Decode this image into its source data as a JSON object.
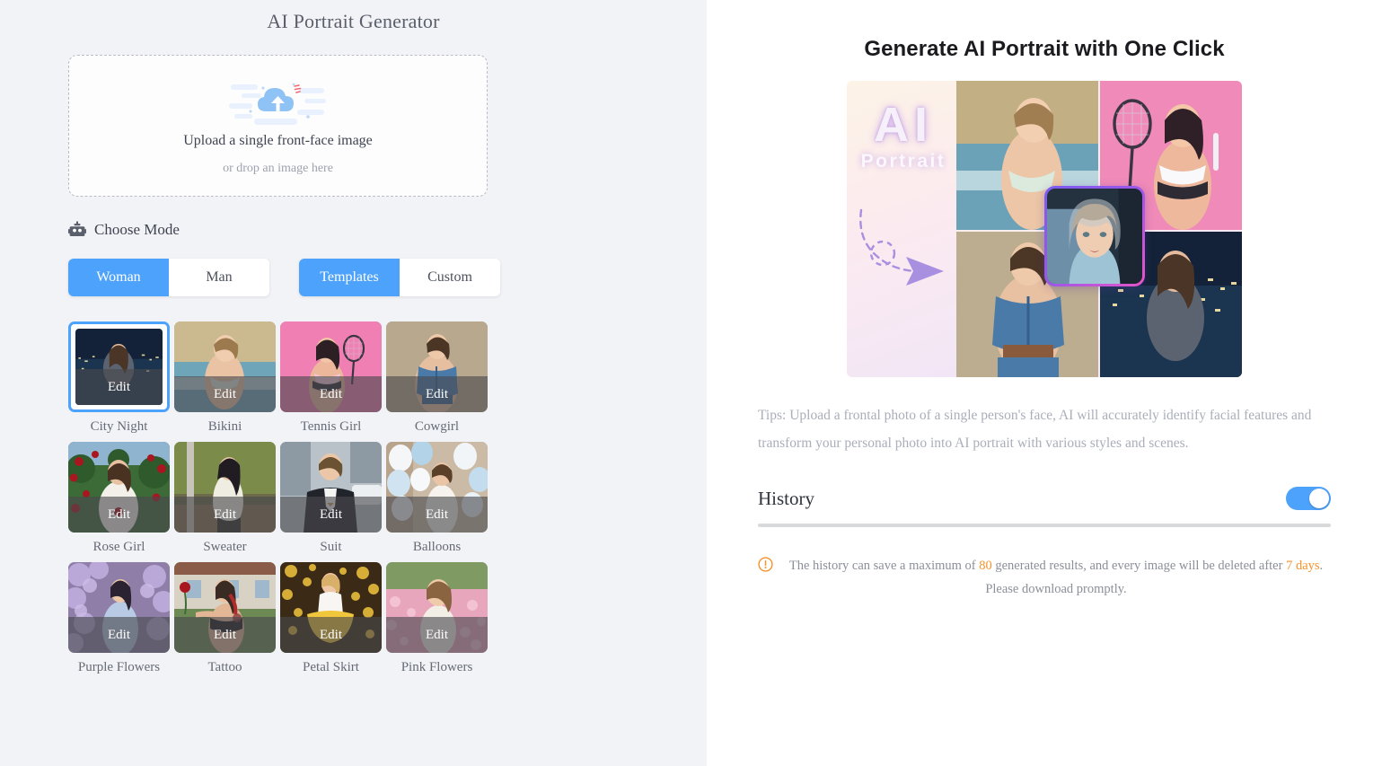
{
  "left": {
    "app_title": "AI Portrait Generator",
    "upload": {
      "icon": "cloud-upload-icon",
      "main_text": "Upload a single front-face image",
      "sub_text": "or drop an image here"
    },
    "mode": {
      "icon": "robot-icon",
      "label": "Choose Mode",
      "gender_options": [
        "Woman",
        "Man"
      ],
      "gender_selected": "Woman",
      "type_options": [
        "Templates",
        "Custom"
      ],
      "type_selected": "Templates"
    },
    "edit_label": "Edit",
    "templates": [
      {
        "name": "City Night",
        "selected": true
      },
      {
        "name": "Bikini",
        "selected": false
      },
      {
        "name": "Tennis Girl",
        "selected": false
      },
      {
        "name": "Cowgirl",
        "selected": false
      },
      {
        "name": "Rose Girl",
        "selected": false
      },
      {
        "name": "Sweater",
        "selected": false
      },
      {
        "name": "Suit",
        "selected": false
      },
      {
        "name": "Balloons",
        "selected": false
      },
      {
        "name": "Purple Flowers",
        "selected": false
      },
      {
        "name": "Tattoo",
        "selected": false
      },
      {
        "name": "Petal Skirt",
        "selected": false
      },
      {
        "name": "Pink Flowers",
        "selected": false
      }
    ]
  },
  "right": {
    "promo_title": "Generate AI Portrait with One Click",
    "collage": {
      "ai_text": "AI",
      "portrait_text": "Portrait",
      "arrow_icon": "dashed-arrow-icon"
    },
    "tips": "Tips: Upload a frontal photo of a single person's face, AI will accurately identify facial features and transform your personal photo into AI portrait with various styles and scenes.",
    "history": {
      "title": "History",
      "toggle_on": true
    },
    "notice": {
      "icon": "warning-circle-icon",
      "part1": "The history can save a maximum of ",
      "max_results": "80",
      "part2": " generated results, and every image will be deleted after ",
      "retention": "7 days",
      "part3": ". Please download promptly."
    }
  },
  "colors": {
    "accent_blue": "#4da2fb",
    "panel_bg": "#f2f3f7",
    "warn_orange": "#f6922b"
  }
}
